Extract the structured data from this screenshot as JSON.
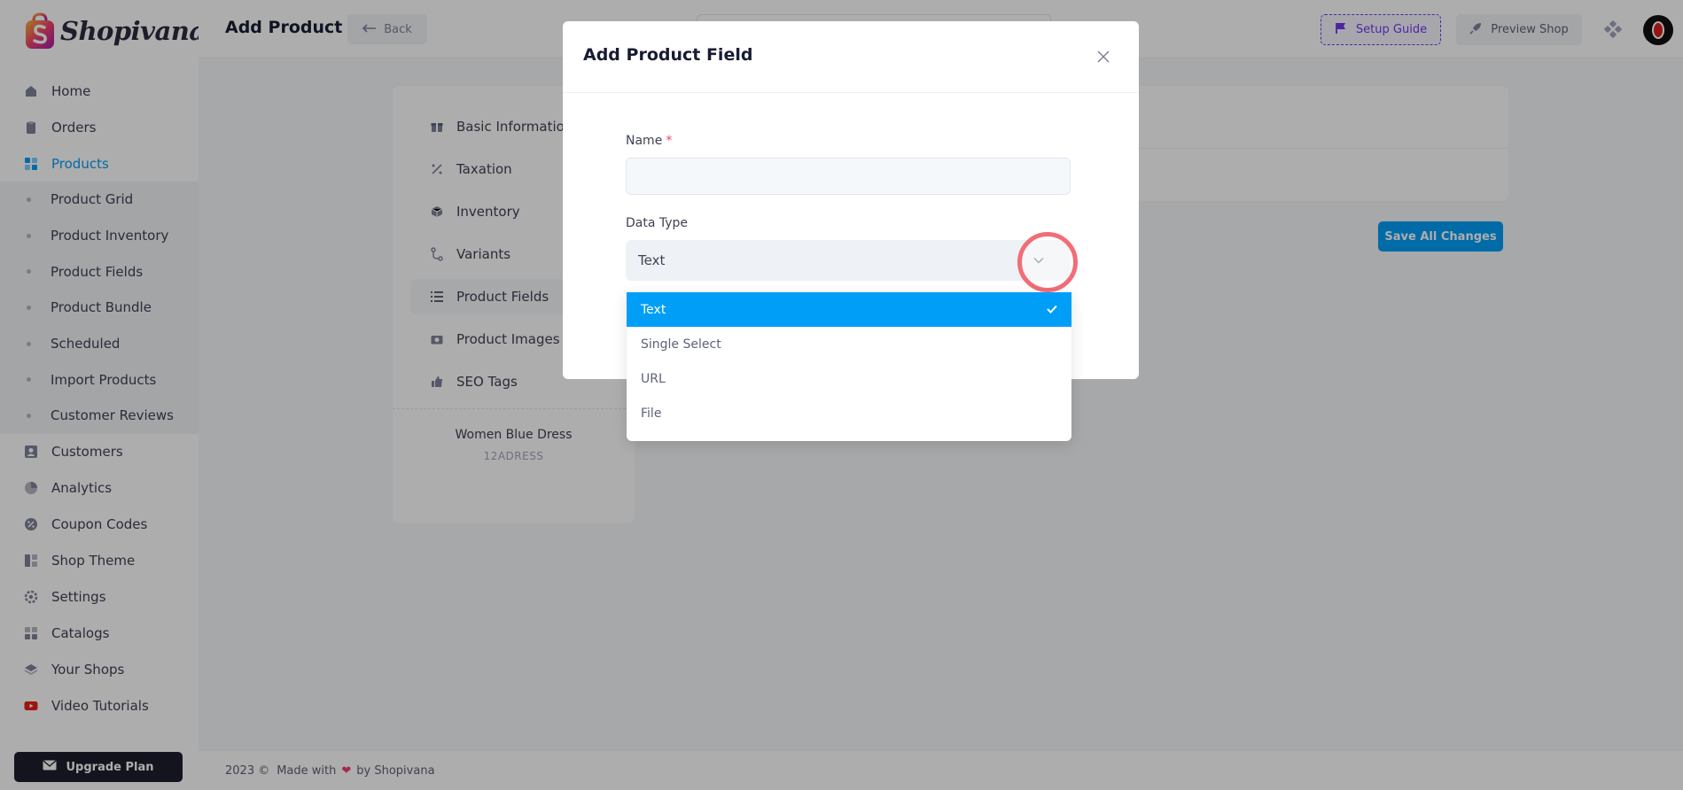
{
  "app": {
    "brand": "Shopivana"
  },
  "sidebar": {
    "items": [
      {
        "label": "Home",
        "icon": "home-icon"
      },
      {
        "label": "Orders",
        "icon": "clipboard-icon"
      },
      {
        "label": "Products",
        "icon": "products-icon",
        "active": true
      }
    ],
    "sub_items": [
      {
        "label": "Product Grid"
      },
      {
        "label": "Product Inventory"
      },
      {
        "label": "Product Fields"
      },
      {
        "label": "Product Bundle"
      },
      {
        "label": "Scheduled"
      },
      {
        "label": "Import Products"
      },
      {
        "label": "Customer Reviews"
      }
    ],
    "items_after": [
      {
        "label": "Customers",
        "icon": "user-card-icon"
      },
      {
        "label": "Analytics",
        "icon": "pie-chart-icon"
      },
      {
        "label": "Coupon Codes",
        "icon": "coupon-icon"
      },
      {
        "label": "Shop Theme",
        "icon": "layout-icon"
      },
      {
        "label": "Settings",
        "icon": "gear-icon"
      },
      {
        "label": "Catalogs",
        "icon": "catalog-icon"
      },
      {
        "label": "Your Shops",
        "icon": "layers-icon"
      },
      {
        "label": "Video Tutorials",
        "icon": "youtube-icon"
      }
    ],
    "upgrade_label": "Upgrade Plan"
  },
  "header": {
    "title": "Add Product",
    "back_label": "Back",
    "setup_label": "Setup Guide",
    "preview_label": "Preview Shop"
  },
  "product_tabs": [
    {
      "label": "Basic Information",
      "icon": "gift-icon"
    },
    {
      "label": "Taxation",
      "icon": "percent-icon"
    },
    {
      "label": "Inventory",
      "icon": "box-icon"
    },
    {
      "label": "Variants",
      "icon": "variants-icon"
    },
    {
      "label": "Product Fields",
      "icon": "list-icon",
      "active": true
    },
    {
      "label": "Product Images",
      "icon": "camera-icon"
    },
    {
      "label": "SEO Tags",
      "icon": "thumbs-up-icon"
    }
  ],
  "product": {
    "name": "Women Blue Dress",
    "sku": "12ADRESS"
  },
  "save_label": "Save All Changes",
  "footer": {
    "year": "2023 ©",
    "made_with": "Made with",
    "by": "by Shopivana"
  },
  "modal": {
    "title": "Add Product Field",
    "name_label": "Name",
    "required_mark": "*",
    "name_value": "",
    "data_type_label": "Data Type",
    "data_type_value": "Text",
    "options": [
      {
        "label": "Text",
        "selected": true
      },
      {
        "label": "Single Select"
      },
      {
        "label": "URL"
      },
      {
        "label": "File"
      }
    ]
  },
  "colors": {
    "primary": "#009ef7",
    "accent": "#7239ea",
    "danger": "#f1416c",
    "dark": "#1e1e2d"
  }
}
